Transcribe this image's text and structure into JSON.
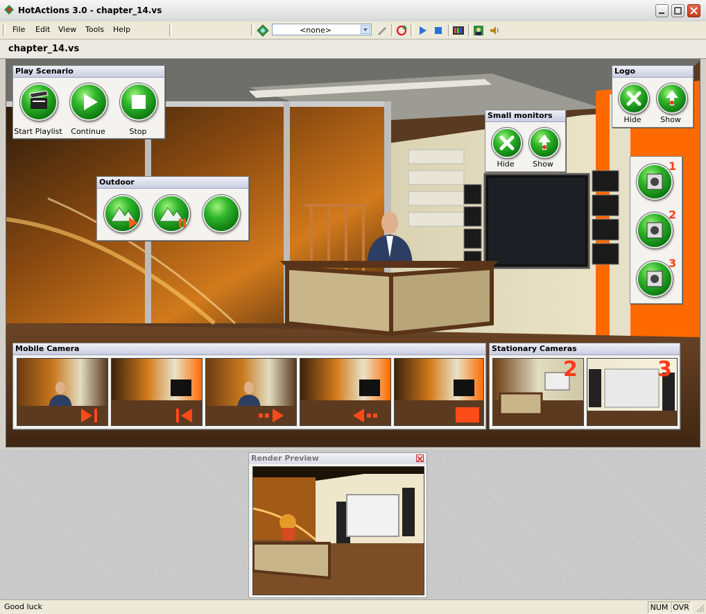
{
  "window": {
    "title": "HotActions 3.0 - chapter_14.vs"
  },
  "menu": [
    "File",
    "Edit",
    "View",
    "Tools",
    "Help"
  ],
  "toolbar": {
    "scenario_value": "<none>"
  },
  "document": {
    "title": "chapter_14.vs"
  },
  "panels": {
    "play_scenario": {
      "title": "Play Scenario",
      "buttons": [
        "Start Playlist",
        "Continue",
        "Stop"
      ]
    },
    "logo": {
      "title": "Logo",
      "buttons": [
        "Hide",
        "Show"
      ]
    },
    "small_monitors": {
      "title": "Small monitors",
      "buttons": [
        "Hide",
        "Show"
      ]
    },
    "outdoor": {
      "title": "Outdoor"
    },
    "side_cameras": {
      "numbers": [
        "1",
        "2",
        "3"
      ]
    },
    "mobile_camera": {
      "title": "Mobile Camera"
    },
    "stationary_cameras": {
      "title": "Stationary Cameras",
      "numbers": [
        "2",
        "3"
      ]
    }
  },
  "render_preview": {
    "title": "Render Preview"
  },
  "status": {
    "message": "Good luck",
    "num": "NUM",
    "ovr": "OVR"
  },
  "colors": {
    "accent_green": "#2fb52a",
    "orange": "#ff6a00",
    "panel_title": "#c9cde0"
  }
}
